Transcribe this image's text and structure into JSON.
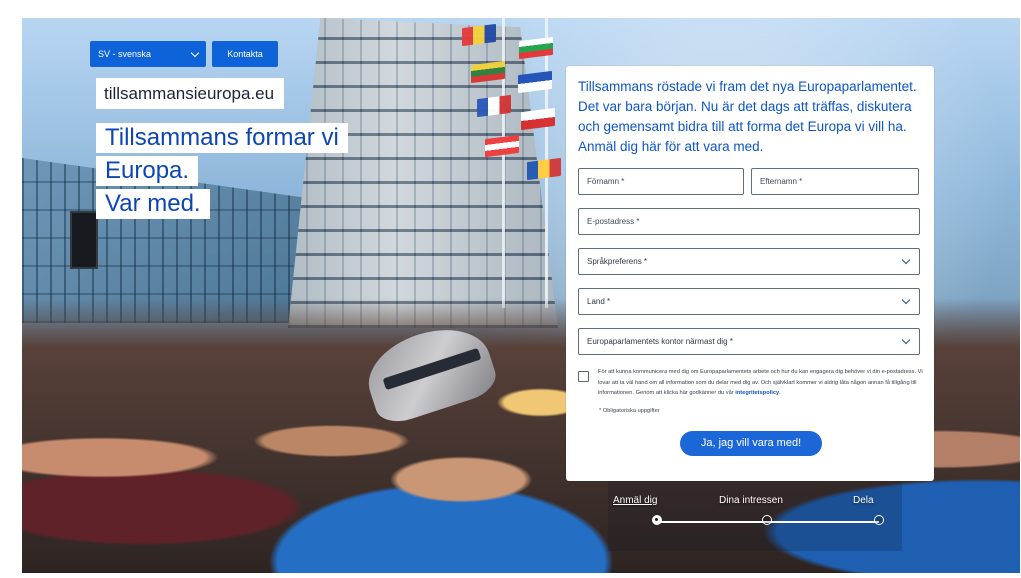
{
  "page": {
    "language_selector": {
      "selected": "SV - svenska",
      "icon": "chevron-down-icon"
    },
    "contact_button": "Kontakta oss",
    "site_name": "tillsammansieuropa.eu",
    "headline": {
      "line_1": "Tillsammans formar vi Europa.",
      "line_2": "Var med."
    }
  },
  "form": {
    "intro": "Tillsammans röstade vi fram det nya Europaparlamentet. Det var bara början. Nu är det dags att träffas, diskutera och gemensamt bidra till att forma det Europa vi vill ha. Anmäl dig här för att vara med.",
    "fields": {
      "first_name": {
        "placeholder": "Förnamn *",
        "value": ""
      },
      "last_name": {
        "placeholder": "Efternamn *",
        "value": ""
      },
      "email": {
        "placeholder": "E-postadress *",
        "value": ""
      }
    },
    "selects": {
      "language_preference": {
        "selected": "Språkpreferens *",
        "icon": "chevron-down-icon"
      },
      "country": {
        "selected": "Land *",
        "icon": "chevron-down-icon"
      },
      "office": {
        "selected": "Europaparlamentets kontor närmast dig *",
        "icon": "chevron-down-icon"
      }
    },
    "consent": {
      "checked": false,
      "text": "För att kunna kommunicera med dig om Europaparlamentets arbete och hur du kan engagera dig behöver vi din e-postadress. Vi lovar att ta väl hand om all information som du delar med dig av. Och självklart kommer vi aldrig låta någon annan få tillgång till informationen. Genom att klicka här godkänner du vår",
      "link": "integritetspolicy"
    },
    "required_note": "* Obligatoriska uppgifter",
    "submit_label": "Ja, jag vill vara med!"
  },
  "progress": {
    "steps": [
      {
        "label": "Anmäl dig",
        "active": true
      },
      {
        "label": "Dina intressen",
        "active": false
      },
      {
        "label": "Dela",
        "active": false
      }
    ]
  },
  "colors": {
    "primary_blue": "#0E63D8",
    "headline_blue": "#0C46B5",
    "form_background": "#FFFFFF"
  }
}
